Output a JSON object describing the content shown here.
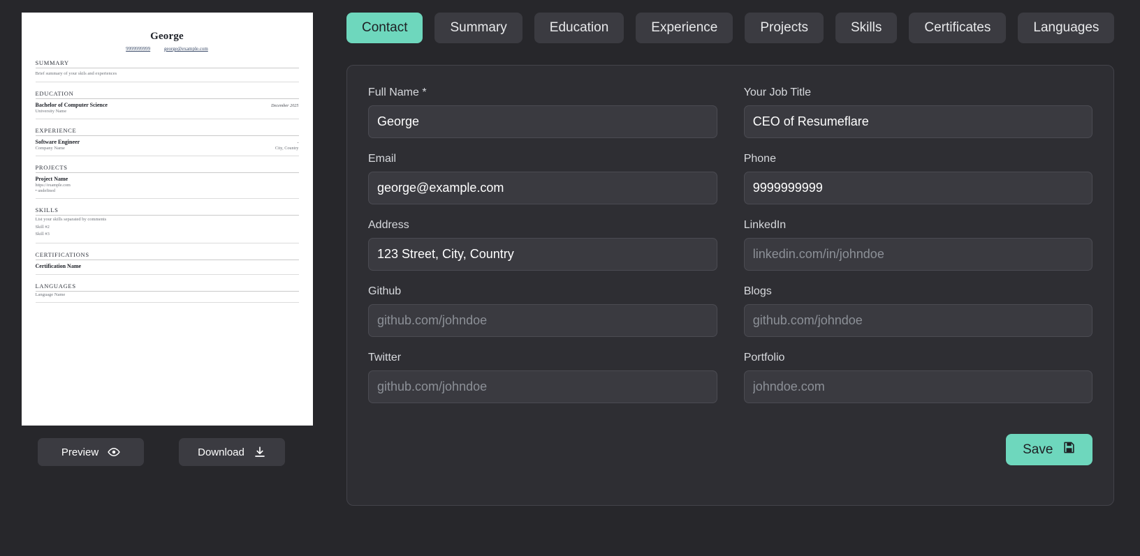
{
  "resume": {
    "name": "George",
    "phone": "9999999999",
    "email": "george@example.com",
    "sections": {
      "summary": {
        "title": "SUMMARY",
        "body": "Brief summary of your skils and experiences"
      },
      "education": {
        "title": "EDUCATION",
        "degree": "Bachelor of Computer Science",
        "school": "University Name",
        "date": "December 2025"
      },
      "experience": {
        "title": "EXPERIENCE",
        "role": "Software Engineer",
        "company": "Company Name",
        "date": "-",
        "location": "City, Country"
      },
      "projects": {
        "title": "PROJECTS",
        "project_name": "Project Name",
        "url": "https://example.com",
        "bullet": "• undefined"
      },
      "skills": {
        "title": "SKILLS",
        "items": [
          "List your skills separated by comments",
          "Skill #2",
          "Skill #3"
        ]
      },
      "certifications": {
        "title": "CERTIFICATIONS",
        "name": "Certification Name"
      },
      "languages": {
        "title": "LANGUAGES",
        "name": "Language Name"
      }
    }
  },
  "actions": {
    "preview_label": "Preview",
    "preview_icon": "eye-icon",
    "download_label": "Download",
    "download_icon": "download-icon"
  },
  "tabs": [
    {
      "label": "Contact",
      "active": true
    },
    {
      "label": "Summary",
      "active": false
    },
    {
      "label": "Education",
      "active": false
    },
    {
      "label": "Experience",
      "active": false
    },
    {
      "label": "Projects",
      "active": false
    },
    {
      "label": "Skills",
      "active": false
    },
    {
      "label": "Certificates",
      "active": false
    },
    {
      "label": "Languages",
      "active": false
    }
  ],
  "form": {
    "fields": [
      {
        "label": "Full Name *",
        "value": "George",
        "placeholder": ""
      },
      {
        "label": "Your Job Title",
        "value": "CEO of Resumeflare",
        "placeholder": ""
      },
      {
        "label": "Email",
        "value": "george@example.com",
        "placeholder": ""
      },
      {
        "label": "Phone",
        "value": "9999999999",
        "placeholder": ""
      },
      {
        "label": "Address",
        "value": "123 Street, City, Country",
        "placeholder": ""
      },
      {
        "label": "LinkedIn",
        "value": "",
        "placeholder": "linkedin.com/in/johndoe"
      },
      {
        "label": "Github",
        "value": "",
        "placeholder": "github.com/johndoe"
      },
      {
        "label": "Blogs",
        "value": "",
        "placeholder": "github.com/johndoe"
      },
      {
        "label": "Twitter",
        "value": "",
        "placeholder": "github.com/johndoe"
      },
      {
        "label": "Portfolio",
        "value": "",
        "placeholder": "johndoe.com"
      }
    ],
    "save_label": "Save",
    "save_icon": "floppy-disk-icon"
  },
  "colors": {
    "accent": "#6ed7bd",
    "page_bg": "#27272b",
    "panel_bg": "#2e2e33",
    "input_bg": "#3a3a40",
    "button_bg": "#3b3b41"
  }
}
